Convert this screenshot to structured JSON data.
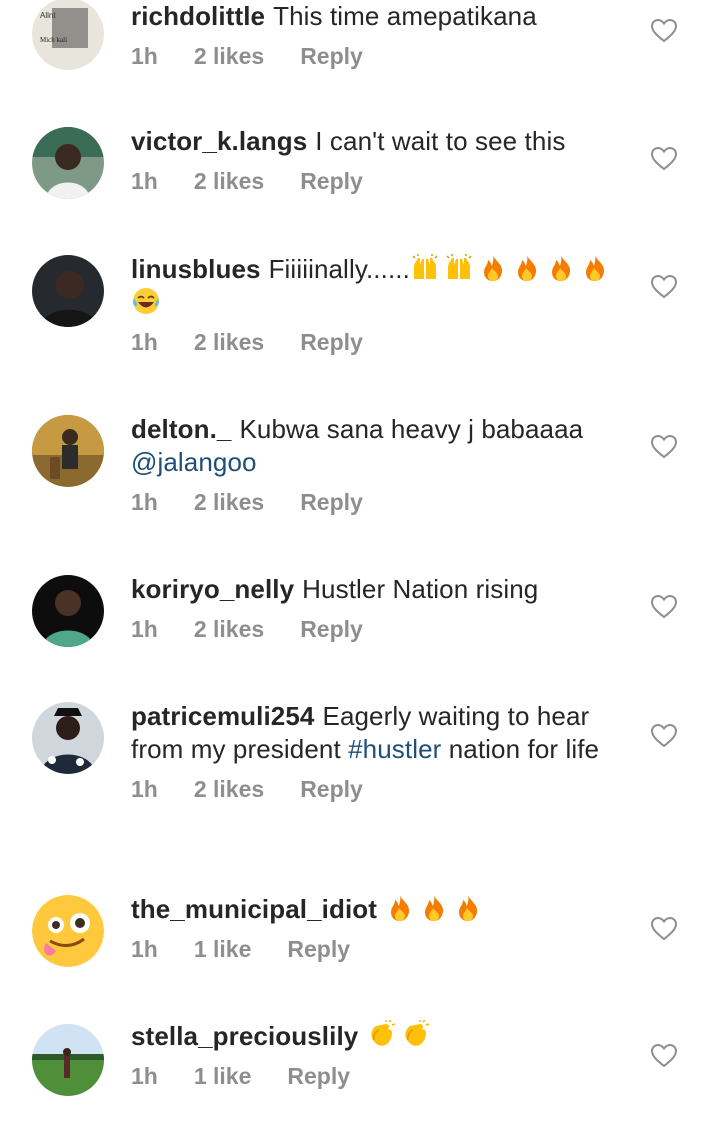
{
  "comments": [
    {
      "user": "richdolittle",
      "text": "This time amepatikana",
      "time": "1h",
      "likes": "2 likes",
      "reply": "Reply"
    },
    {
      "user": "victor_k.langs",
      "text": "I can't wait to see this",
      "time": "1h",
      "likes": "2 likes",
      "reply": "Reply"
    },
    {
      "user": "linusblues",
      "text": "Fiiiiinally......",
      "time": "1h",
      "likes": "2 likes",
      "reply": "Reply"
    },
    {
      "user": "delton._",
      "text": "Kubwa sana heavy j babaaaa",
      "mention": "@jalangoo",
      "time": "1h",
      "likes": "2 likes",
      "reply": "Reply"
    },
    {
      "user": "koriryo_nelly",
      "text": "Hustler Nation rising",
      "time": "1h",
      "likes": "2 likes",
      "reply": "Reply"
    },
    {
      "user": "patricemuli254",
      "text_a": "Eagerly waiting to hear from my president",
      "hashtag": "#hustler",
      "text_b": "nation for life",
      "time": "1h",
      "likes": "2 likes",
      "reply": "Reply"
    },
    {
      "user": "the_municipal_idiot",
      "text": "",
      "time": "1h",
      "likes": "1 like",
      "reply": "Reply"
    },
    {
      "user": "stella_preciouslily",
      "text": "",
      "time": "1h",
      "likes": "1 like",
      "reply": "Reply"
    }
  ],
  "icons": {
    "like": "heart-outline-icon"
  }
}
